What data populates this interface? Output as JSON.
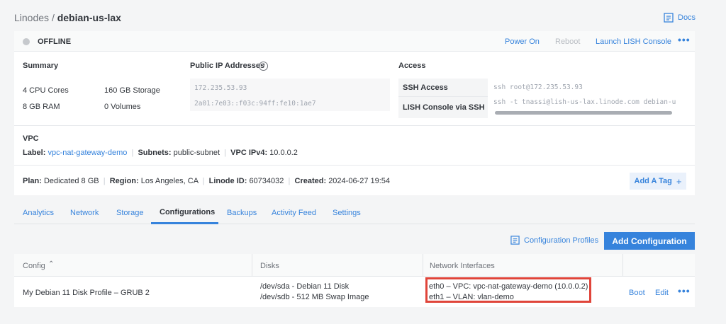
{
  "breadcrumb": {
    "parent": "Linodes",
    "separator": "/",
    "current": "debian-us-lax"
  },
  "docs": {
    "label": "Docs"
  },
  "status": {
    "label": "OFFLINE"
  },
  "actions": {
    "power_on": "Power On",
    "reboot": "Reboot",
    "lish": "Launch LISH Console"
  },
  "summary": {
    "title": "Summary",
    "cpu": "4 CPU Cores",
    "storage": "160 GB Storage",
    "ram": "8 GB RAM",
    "volumes": "0 Volumes"
  },
  "ips": {
    "title": "Public IP Addresses",
    "ipv4": "172.235.53.93",
    "ipv6": "2a01:7e03::f03c:94ff:fe10:1ae7"
  },
  "access": {
    "title": "Access",
    "ssh_label": "SSH Access",
    "ssh_value": "ssh root@172.235.53.93",
    "lish_label": "LISH Console via SSH",
    "lish_value": "ssh -t tnassi@lish-us-lax.linode.com debian-u"
  },
  "vpc": {
    "title": "VPC",
    "label_key": "Label:",
    "label_value": "vpc-nat-gateway-demo",
    "subnets_key": "Subnets:",
    "subnets_value": "public-subnet",
    "ipv4_key": "VPC IPv4:",
    "ipv4_value": "10.0.0.2"
  },
  "meta": {
    "plan_key": "Plan:",
    "plan_value": "Dedicated 8 GB",
    "region_key": "Region:",
    "region_value": "Los Angeles, CA",
    "id_key": "Linode ID:",
    "id_value": "60734032",
    "created_key": "Created:",
    "created_value": "2024-06-27 19:54",
    "add_tag": "Add A Tag"
  },
  "tabs": [
    "Analytics",
    "Network",
    "Storage",
    "Configurations",
    "Backups",
    "Activity Feed",
    "Settings"
  ],
  "config_actions": {
    "profiles": "Configuration Profiles",
    "add": "Add Configuration"
  },
  "table": {
    "headers": {
      "config": "Config",
      "disks": "Disks",
      "interfaces": "Network Interfaces"
    },
    "row": {
      "config": "My Debian 11 Disk Profile – GRUB 2",
      "disk1": "/dev/sda - Debian 11 Disk",
      "disk2": "/dev/sdb - 512 MB Swap Image",
      "iface1": "eth0 – VPC: vpc-nat-gateway-demo (10.0.0.2)",
      "iface2": "eth1 – VLAN: vlan-demo",
      "boot": "Boot",
      "edit": "Edit"
    }
  },
  "colors": {
    "accent": "#3683dc",
    "highlight": "#e0453a",
    "status_offline": "#c6c9cd"
  }
}
